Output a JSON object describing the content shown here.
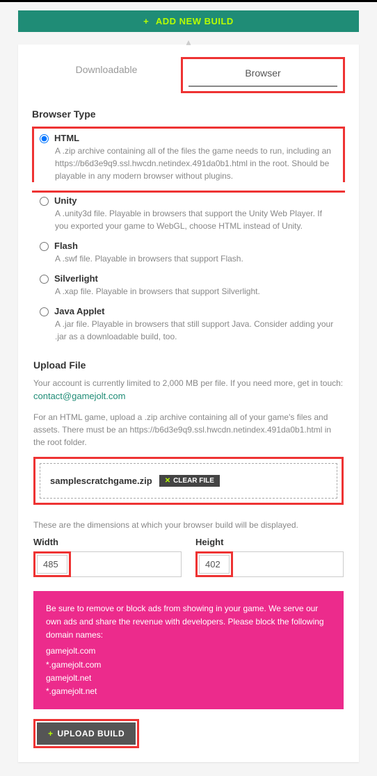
{
  "header": {
    "add_new_build": "ADD NEW BUILD"
  },
  "tabs": {
    "downloadable": "Downloadable",
    "browser": "Browser"
  },
  "browser_type": {
    "label": "Browser Type",
    "options": {
      "html": {
        "label": "HTML",
        "desc": "A .zip archive containing all of the files the game needs to run, including an https://b6d3e9q9.ssl.hwcdn.netindex.491da0b1.html in the root. Should be playable in any modern browser without plugins."
      },
      "unity": {
        "label": "Unity",
        "desc": "A .unity3d file. Playable in browsers that support the Unity Web Player. If you exported your game to WebGL, choose HTML instead of Unity."
      },
      "flash": {
        "label": "Flash",
        "desc": "A .swf file. Playable in browsers that support Flash."
      },
      "silverlight": {
        "label": "Silverlight",
        "desc": "A .xap file. Playable in browsers that support Silverlight."
      },
      "java": {
        "label": "Java Applet",
        "desc": "A .jar file. Playable in browsers that still support Java. Consider adding your .jar as a downloadable build, too."
      }
    }
  },
  "upload": {
    "label": "Upload File",
    "limit_text": "Your account is currently limited to 2,000 MB per file. If you need more, get in touch:",
    "contact": "contact@gamejolt.com",
    "html_note": "For an HTML game, upload a .zip archive containing all of your game's files and assets. There must be an https://b6d3e9q9.ssl.hwcdn.netindex.491da0b1.html in the root folder.",
    "file_name": "samplescratchgame.zip",
    "clear_label": "CLEAR FILE"
  },
  "dimensions": {
    "note": "These are the dimensions at which your browser build will be displayed.",
    "width_label": "Width",
    "height_label": "Height",
    "width_value": "485",
    "height_value": "402"
  },
  "ads_note": {
    "text": "Be sure to remove or block ads from showing in your game. We serve our own ads and share the revenue with developers. Please block the following domain names:",
    "d1": "gamejolt.com",
    "d2": "*.gamejolt.com",
    "d3": "gamejolt.net",
    "d4": "*.gamejolt.net"
  },
  "upload_button": "UPLOAD BUILD"
}
